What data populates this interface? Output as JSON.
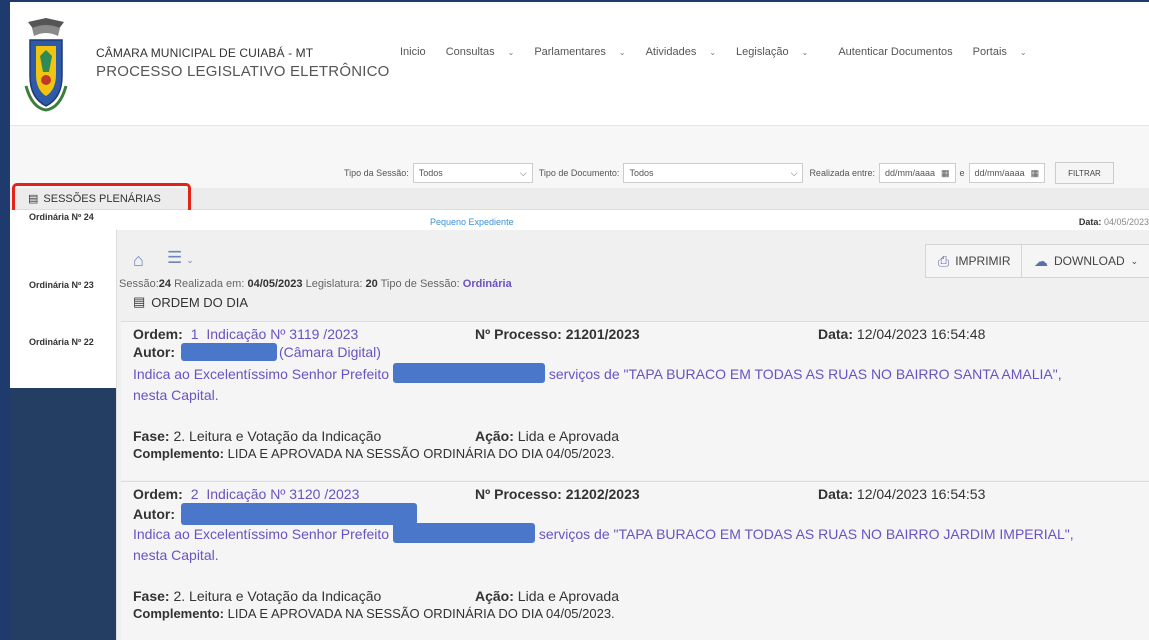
{
  "header": {
    "org_line1": "CÂMARA MUNICIPAL DE CUIABÁ - MT",
    "org_line2": "PROCESSO LEGISLATIVO ELETRÔNICO",
    "nav": [
      {
        "label": "Inicio",
        "has_menu": false
      },
      {
        "label": "Consultas",
        "has_menu": true
      },
      {
        "label": "Parlamentares",
        "has_menu": true
      },
      {
        "label": "Atividades",
        "has_menu": true
      },
      {
        "label": "Legislação",
        "has_menu": true
      },
      {
        "label": "Autenticar Documentos",
        "has_menu": false
      },
      {
        "label": "Portais",
        "has_menu": true
      }
    ]
  },
  "filters": {
    "tipo_sessao_label": "Tipo da Sessão:",
    "tipo_sessao_value": "Todos",
    "tipo_documento_label": "Tipo de Documento:",
    "tipo_documento_value": "Todos",
    "realizada_label": "Realizada entre:",
    "date_from_placeholder": "dd/mm/aaaa",
    "date_sep": "e",
    "date_to_placeholder": "dd/mm/aaaa",
    "filtrar_button": "FILTRAR"
  },
  "section_title": "SESSÕES PLENÁRIAS",
  "sidebar": {
    "items": [
      "Ordinária Nº 24",
      "Ordinária Nº 23",
      "Ordinária Nº 22"
    ]
  },
  "row_top": {
    "pequeno_expediente": "Pequeno Expediente",
    "data_label": "Data:",
    "data_value": "04/05/2023"
  },
  "toolbar": {
    "imprimir": "IMPRIMIR",
    "download": "DOWNLOAD"
  },
  "session_info": {
    "sessao_label": "Sessão:",
    "sessao_value": "24",
    "realizada_label": "Realizada em:",
    "realizada_value": "04/05/2023",
    "legislatura_label": "Legislatura:",
    "legislatura_value": "20",
    "tipo_label": "Tipo de Sessão:",
    "tipo_value": "Ordinária"
  },
  "ordem_title": "ORDEM DO DIA",
  "items": [
    {
      "ordem_label": "Ordem:",
      "ordem_num": "1",
      "indicacao": "Indicação Nº 3119 /2023",
      "processo": "Nº Processo: 21201/2023",
      "data_label": "Data:",
      "data_value": "12/04/2023 16:54:48",
      "autor_label": "Autor:",
      "autor_suffix": "(Câmara Digital)",
      "desc_pre": "Indica ao Excelentíssimo Senhor Prefeito",
      "desc_post": "serviços de \"TAPA BURACO EM TODAS AS RUAS NO BAIRRO SANTA AMALIA\",",
      "desc_line2": "nesta Capital.",
      "fase_label": "Fase:",
      "fase_value": "2. Leitura e Votação da Indicação",
      "acao_label": "Ação:",
      "acao_value": "Lida e Aprovada",
      "comp_label": "Complemento:",
      "comp_value": "LIDA E APROVADA NA SESSÃO ORDINÁRIA DO DIA 04/05/2023."
    },
    {
      "ordem_label": "Ordem:",
      "ordem_num": "2",
      "indicacao": "Indicação Nº 3120 /2023",
      "processo": "Nº Processo: 21202/2023",
      "data_label": "Data:",
      "data_value": "12/04/2023 16:54:53",
      "autor_label": "Autor:",
      "autor_suffix": "",
      "desc_pre": "Indica ao Excelentíssimo Senhor Prefeito",
      "desc_post": "serviços de \"TAPA BURACO EM TODAS AS RUAS NO BAIRRO JARDIM IMPERIAL\",",
      "desc_line2": "nesta Capital.",
      "fase_label": "Fase:",
      "fase_value": "2. Leitura e Votação da Indicação",
      "acao_label": "Ação:",
      "acao_value": "Lida e Aprovada",
      "comp_label": "Complemento:",
      "comp_value": "LIDA E APROVADA NA SESSÃO ORDINÁRIA DO DIA 04/05/2023."
    }
  ],
  "colors": {
    "accent_purple": "#6a52c2",
    "link_blue": "#3a8fd8",
    "sidebar_navy": "#233d63",
    "highlight_red": "#e2231a",
    "redaction": "#4a77c9"
  },
  "icons": {
    "home": "home-icon",
    "menu": "list-menu-icon",
    "print": "printer-icon",
    "download": "cloud-download-icon",
    "section": "list-box-icon",
    "calendar": "calendar-icon"
  }
}
